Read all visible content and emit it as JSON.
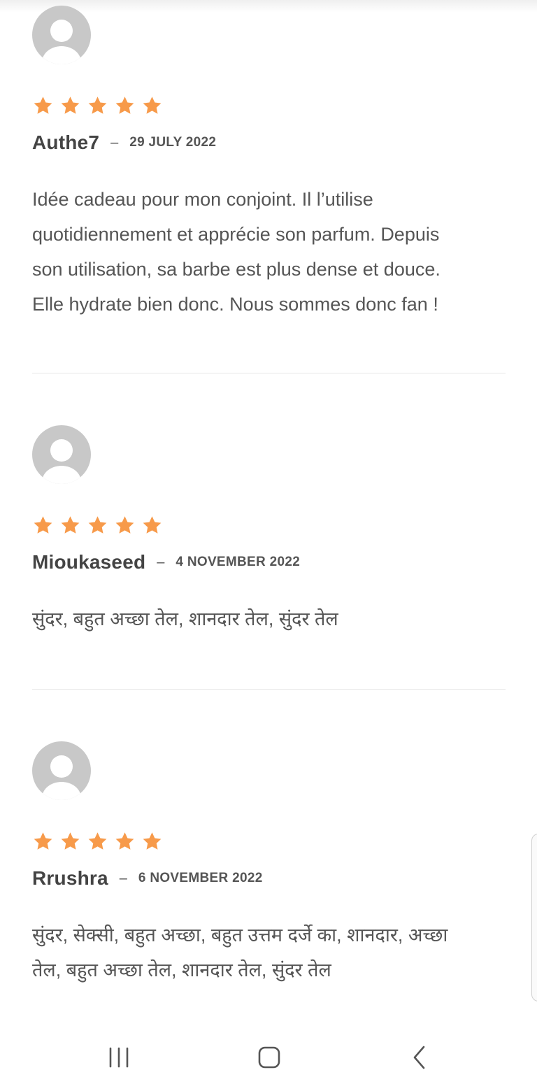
{
  "reviews": [
    {
      "author": "Authe7",
      "separator": "–",
      "date": "29 JULY 2022",
      "rating": 5,
      "text_lines": [
        "Idée cadeau pour mon conjoint. Il l’utilise",
        "quotidiennement et apprécie son parfum. Depuis",
        "son utilisation, sa barbe est plus dense et douce.",
        "Elle hydrate bien donc. Nous sommes donc fan !"
      ]
    },
    {
      "author": "Mioukaseed",
      "separator": "–",
      "date": "4 NOVEMBER 2022",
      "rating": 5,
      "text_lines": [
        "सुंदर, बहुत अच्छा तेल, शानदार तेल, सुंदर तेल"
      ]
    },
    {
      "author": "Rrushra",
      "separator": "–",
      "date": "6 NOVEMBER 2022",
      "rating": 5,
      "text_lines": [
        "सुंदर, सेक्सी, बहुत अच्छा, बहुत उत्तम दर्जे का, शानदार, अच्छा",
        "तेल, बहुत अच्छा तेल, शानदार तेल, सुंदर तेल"
      ]
    }
  ],
  "icons": {
    "avatar": "default-user-avatar-icon",
    "star": "star-icon",
    "nav_recents": "recent-apps-icon",
    "nav_home": "home-icon",
    "nav_back": "back-icon"
  },
  "colors": {
    "star": "#F79A4A",
    "avatar": "#C8C8C8",
    "author": "#444444",
    "text": "#555555",
    "divider": "#E6E6E6",
    "nav_icon": "#555555"
  }
}
